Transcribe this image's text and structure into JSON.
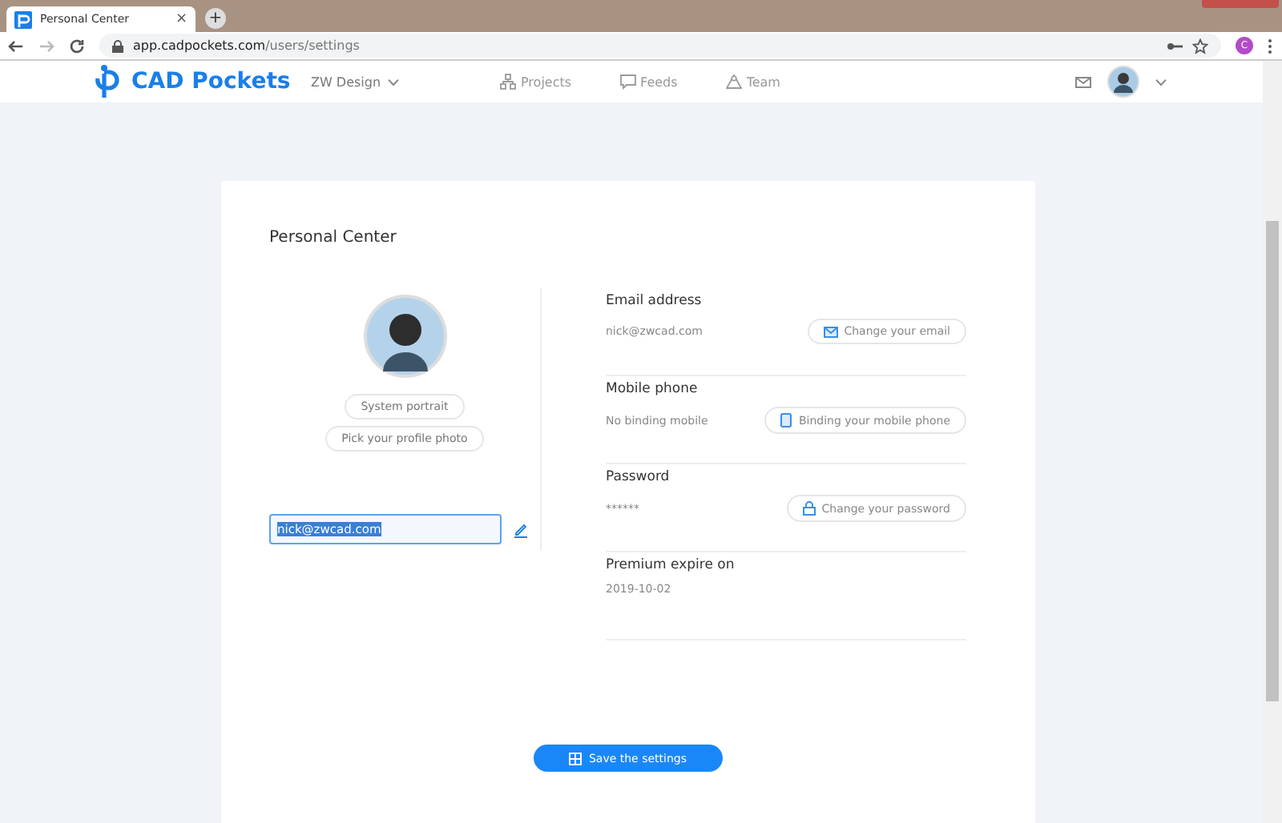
{
  "browser": {
    "tab_title": "Personal Center",
    "tab_close": "×",
    "new_tab": "+",
    "url_host": "app.cadpockets.com",
    "url_path": "/users/settings",
    "profile_initial": "C"
  },
  "header": {
    "logo": "CAD Pockets",
    "workspace": "ZW Design",
    "nav": [
      {
        "label": "Projects",
        "kind": "projects"
      },
      {
        "label": "Feeds",
        "kind": "feeds"
      },
      {
        "label": "Team",
        "kind": "team"
      }
    ]
  },
  "card": {
    "title": "Personal Center",
    "portrait_buttons": [
      "System portrait",
      "Pick your profile photo"
    ],
    "name_field": {
      "value": "nick@zwcad.com"
    },
    "rows": [
      {
        "label": "Email address",
        "value": "nick@zwcad.com",
        "button": "Change your email",
        "kind": "email"
      },
      {
        "label": "Mobile phone",
        "value": "No binding mobile",
        "button": "Binding your mobile phone",
        "kind": "phone"
      },
      {
        "label": "Password",
        "value": "******",
        "button": "Change your password",
        "kind": "password"
      },
      {
        "label": "Premium expire on",
        "value": "2019-10-02"
      }
    ],
    "save_button": "Save the settings"
  }
}
